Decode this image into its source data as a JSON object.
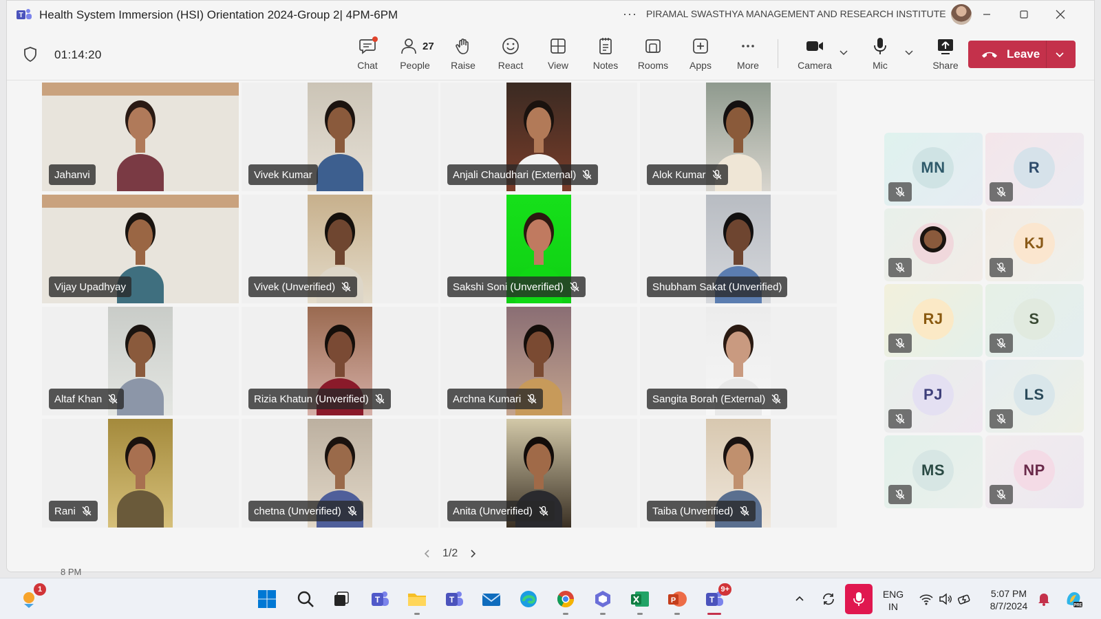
{
  "window": {
    "title": "Health System Immersion (HSI) Orientation 2024-Group 2| 4PM-6PM",
    "org": "PIRAMAL SWASTHYA MANAGEMENT AND RESEARCH INSTITUTE",
    "more_dots": "···"
  },
  "toolbar": {
    "timer": "01:14:20",
    "people_count": "27",
    "buttons": {
      "chat": "Chat",
      "people": "People",
      "raise": "Raise",
      "react": "React",
      "view": "View",
      "notes": "Notes",
      "rooms": "Rooms",
      "apps": "Apps",
      "more": "More",
      "camera": "Camera",
      "mic": "Mic",
      "share": "Share"
    },
    "leave_label": "Leave",
    "leave_color": "#c4314b"
  },
  "participants": [
    {
      "name": "Jahanvi",
      "muted": false
    },
    {
      "name": "Vivek Kumar",
      "muted": false
    },
    {
      "name": "Anjali Chaudhari (External)",
      "muted": true
    },
    {
      "name": "Alok Kumar",
      "muted": true
    },
    {
      "name": "Vijay Upadhyay",
      "muted": false
    },
    {
      "name": "Vivek (Unverified)",
      "muted": true
    },
    {
      "name": "Sakshi Soni (Unverified)",
      "muted": true
    },
    {
      "name": "Shubham Sakat (Unverified)",
      "muted": false
    },
    {
      "name": "Altaf Khan",
      "muted": true
    },
    {
      "name": "Rizia Khatun (Unverified)",
      "muted": true
    },
    {
      "name": "Archna Kumari",
      "muted": true
    },
    {
      "name": "Sangita Borah (External)",
      "muted": true
    },
    {
      "name": "Rani",
      "muted": true
    },
    {
      "name": "chetna (Unverified)",
      "muted": true
    },
    {
      "name": "Anita (Unverified)",
      "muted": true
    },
    {
      "name": "Taiba (Unverified)",
      "muted": true
    }
  ],
  "side_panel": [
    {
      "initials": "MN"
    },
    {
      "initials": "R"
    },
    {
      "initials": ""
    },
    {
      "initials": "KJ"
    },
    {
      "initials": "RJ"
    },
    {
      "initials": "S"
    },
    {
      "initials": "PJ"
    },
    {
      "initials": "LS"
    },
    {
      "initials": "MS"
    },
    {
      "initials": "NP"
    }
  ],
  "pager": {
    "label": "1/2"
  },
  "background_label": "8 PM",
  "taskbar": {
    "weather_badge": "1",
    "teams_badge": "9+",
    "lang_line1": "ENG",
    "lang_line2": "IN",
    "time": "5:07 PM",
    "date": "8/7/2024"
  }
}
